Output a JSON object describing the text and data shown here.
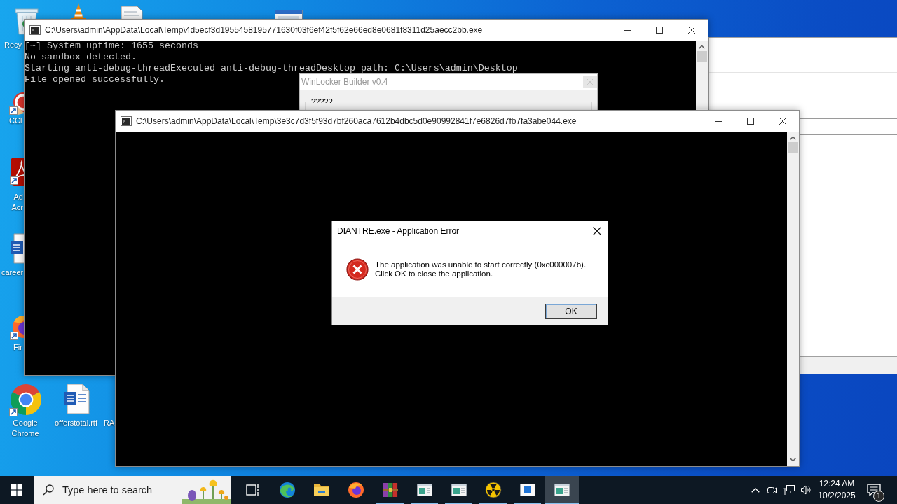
{
  "desktop_icons": [
    {
      "kind": "recycle-bin",
      "label": "Recy"
    },
    {
      "kind": "cone"
    },
    {
      "kind": "document"
    },
    {
      "kind": "window"
    },
    {
      "kind": "ccleaner",
      "label": "CCl"
    },
    {
      "kind": "acrobat",
      "label": "Ad Acr"
    },
    {
      "kind": "word",
      "label": "career"
    },
    {
      "kind": "firefox",
      "label": "Fir"
    },
    {
      "kind": "chrome",
      "label": "Google Chrome"
    },
    {
      "kind": "word",
      "label": "offerstotal.rtf"
    },
    {
      "label": "RA"
    }
  ],
  "console_windows": [
    {
      "title": "C:\\Users\\admin\\AppData\\Local\\Temp\\4d5ecf3d1955458195771630f03f6ef42f5f62e66ed8e0681f8311d25aecc2bb.exe",
      "lines": [
        "[~] System uptime: 1655 seconds",
        "No sandbox detected.",
        "Starting anti-debug-threadExecuted anti-debug-threadDesktop path: C:\\Users\\admin\\Desktop",
        "File opened successfully."
      ]
    },
    {
      "title": "C:\\Users\\admin\\AppData\\Local\\Temp\\3e3c7d3f5f93d7bf260aca7612b4dbc5d0e90992841f7e6826d7fb7fa3abe044.exe"
    }
  ],
  "winlocker_window": {
    "title": "WinLocker Builder v0.4",
    "group_label": "?????"
  },
  "error_dialog": {
    "title": "DIANTRE.exe - Application Error",
    "message": "The application was unable to start correctly (0xc000007b).\nClick OK to close the application.",
    "button": "OK"
  },
  "taskbar": {
    "search": {
      "placeholder": "Type here to search"
    },
    "apps": [
      {
        "kind": "taskview",
        "running": false,
        "selected": false
      },
      {
        "kind": "edge",
        "running": false,
        "selected": false
      },
      {
        "kind": "explorer",
        "running": false,
        "selected": false
      },
      {
        "kind": "firefox",
        "running": false,
        "selected": false
      },
      {
        "kind": "winrar",
        "running": true,
        "selected": false
      },
      {
        "kind": "window",
        "running": true,
        "selected": false
      },
      {
        "kind": "window",
        "running": true,
        "selected": false
      },
      {
        "kind": "radiation",
        "running": true,
        "selected": false
      },
      {
        "kind": "bluewindow",
        "running": true,
        "selected": false
      },
      {
        "kind": "window",
        "running": true,
        "selected": true
      }
    ],
    "tray": {
      "time": "12:24 AM",
      "date": "10/2/2025",
      "notifications": "1"
    }
  }
}
